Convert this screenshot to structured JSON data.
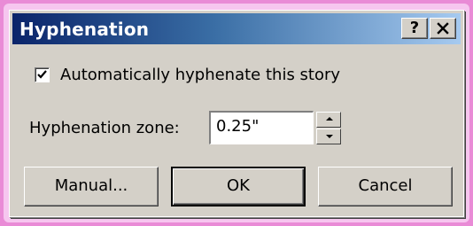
{
  "dialog": {
    "title": "Hyphenation",
    "help_button": "?",
    "close_button": "✕"
  },
  "options": {
    "auto_hyphenate_label": "Automatically hyphenate this story",
    "auto_hyphenate_checked": true
  },
  "zone": {
    "label": "Hyphenation zone:",
    "value": "0.25\""
  },
  "buttons": {
    "manual": "Manual...",
    "ok": "OK",
    "cancel": "Cancel"
  },
  "colors": {
    "titlebar_start": "#0a246a",
    "titlebar_end": "#a6caf0",
    "dialog_face": "#d4d0c8",
    "outer_glow": "#e98bd6"
  }
}
